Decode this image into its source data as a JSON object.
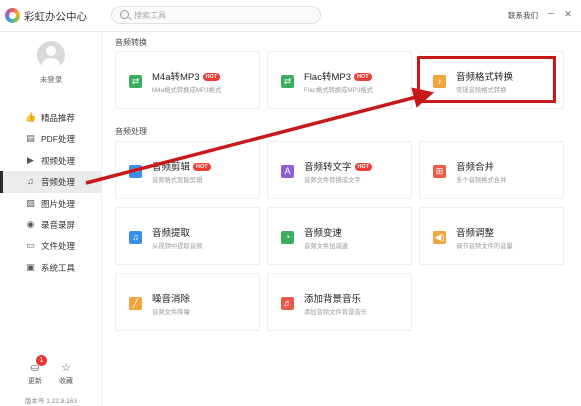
{
  "app": {
    "title": "彩虹办公中心"
  },
  "search": {
    "placeholder": "搜索工具"
  },
  "header": {
    "contact": "联系我们",
    "minimize": "－",
    "close": "✕"
  },
  "user": {
    "login_label": "未登录"
  },
  "sidebar": {
    "items": [
      {
        "label": "精品推荐",
        "icon": "thumbs-up-icon",
        "glyph": "👍",
        "active": false
      },
      {
        "label": "PDF处理",
        "icon": "pdf-icon",
        "glyph": "▤",
        "active": false
      },
      {
        "label": "视频处理",
        "icon": "video-icon",
        "glyph": "▶",
        "active": false
      },
      {
        "label": "音频处理",
        "icon": "music-note-icon",
        "glyph": "♫",
        "active": true
      },
      {
        "label": "图片处理",
        "icon": "image-icon",
        "glyph": "▨",
        "active": false
      },
      {
        "label": "录音录屏",
        "icon": "record-icon",
        "glyph": "◉",
        "active": false
      },
      {
        "label": "文件处理",
        "icon": "folder-icon",
        "glyph": "▭",
        "active": false
      },
      {
        "label": "系统工具",
        "icon": "monitor-icon",
        "glyph": "▣",
        "active": false
      }
    ],
    "update_label": "更新",
    "update_badge": "1",
    "favorite_label": "收藏",
    "version": "版本号 1.22.8.163"
  },
  "sections": [
    {
      "title": "音频转换",
      "cards": [
        {
          "title": "M4a转MP3",
          "desc": "M4a格式转换成MP3格式",
          "hot": true,
          "icon": "convert-icon",
          "glyph": "⇄",
          "color": "#3aae5e"
        },
        {
          "title": "Flac转MP3",
          "desc": "Flac格式转换成MP3格式",
          "hot": true,
          "icon": "convert-icon",
          "glyph": "⇄",
          "color": "#3aae5e"
        },
        {
          "title": "音频格式转换",
          "desc": "常规音频格式转换",
          "hot": false,
          "icon": "music-file-icon",
          "glyph": "♪",
          "color": "#f0a53a"
        }
      ]
    },
    {
      "title": "音频处理",
      "cards": [
        {
          "title": "音频剪辑",
          "desc": "音频格式智能剪辑",
          "hot": true,
          "icon": "scissors-icon",
          "glyph": "✂",
          "color": "#3a8ee8"
        },
        {
          "title": "音频转文字",
          "desc": "音频文件转换成文字",
          "hot": true,
          "icon": "text-icon",
          "glyph": "A",
          "color": "#8a5fd8"
        },
        {
          "title": "音频合并",
          "desc": "多个音频格式合并",
          "hot": false,
          "icon": "merge-icon",
          "glyph": "⊞",
          "color": "#ea5a4a"
        },
        {
          "title": "音频提取",
          "desc": "从视频中提取音频",
          "hot": false,
          "icon": "extract-icon",
          "glyph": "♫",
          "color": "#3a8ee8"
        },
        {
          "title": "音频变速",
          "desc": "音频文件加减速",
          "hot": false,
          "icon": "speed-icon",
          "glyph": "◔",
          "color": "#3aae5e"
        },
        {
          "title": "音频调整",
          "desc": "调节音频文件的音量",
          "hot": false,
          "icon": "volume-icon",
          "glyph": "◀)",
          "color": "#f0a53a"
        },
        {
          "title": "噪音消除",
          "desc": "音频文件降噪",
          "hot": false,
          "icon": "noise-icon",
          "glyph": "╱",
          "color": "#f0a53a"
        },
        {
          "title": "添加背景音乐",
          "desc": "添加音频文件背景音乐",
          "hot": false,
          "icon": "add-music-icon",
          "glyph": "♬",
          "color": "#ea5a4a"
        }
      ]
    }
  ],
  "hot_label": "HOT",
  "annotation": {
    "color": "#c8191a"
  }
}
